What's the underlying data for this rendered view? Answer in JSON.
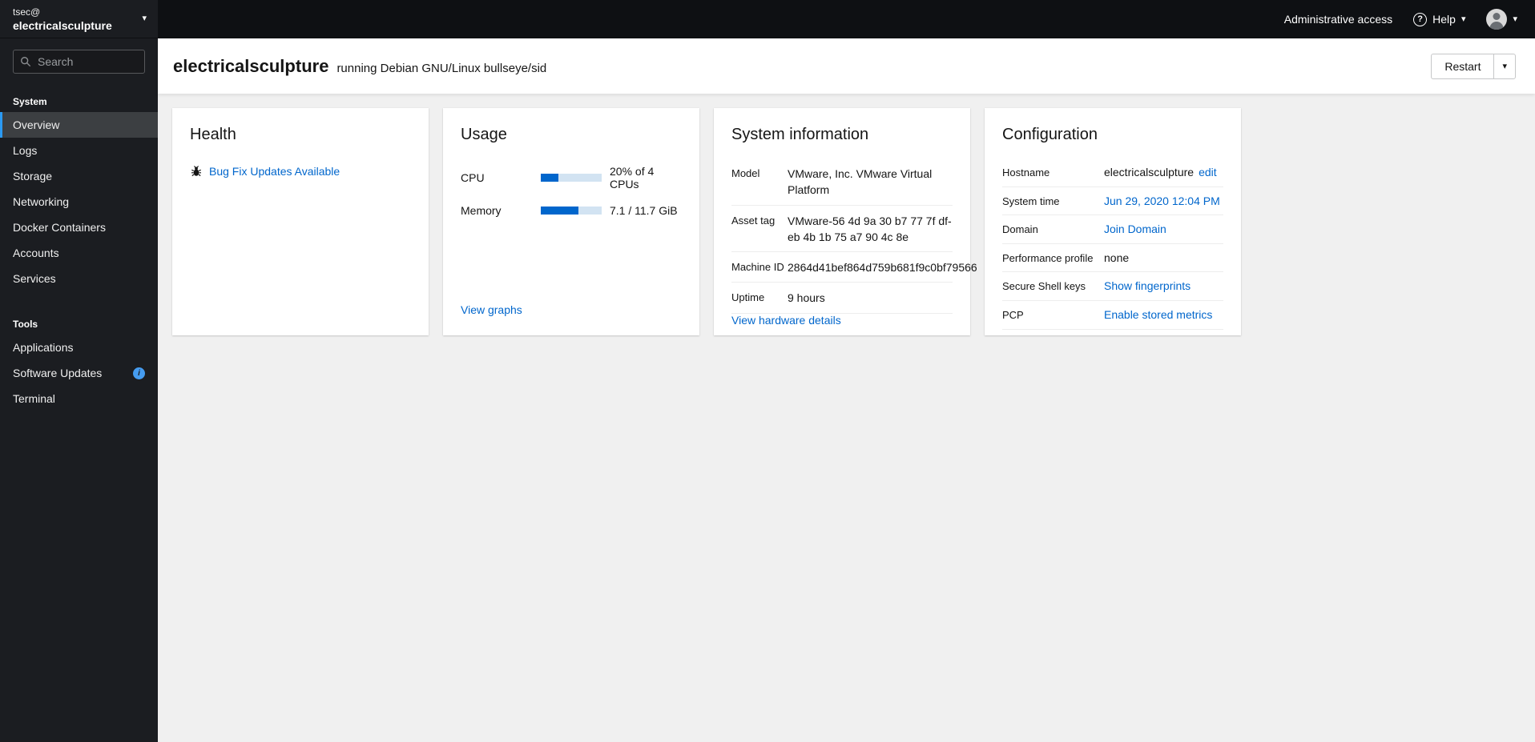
{
  "colors": {
    "accent_blue": "#0066cc",
    "masthead_bg": "#0e1013",
    "sidebar_bg": "#1b1d21",
    "selected_border": "#2b9af3",
    "progress_fill": "#0066cc",
    "progress_track": "#d2e3f2",
    "info_badge": "#459cf0"
  },
  "icons": {
    "caret_down": "▾",
    "question": "?",
    "info": "i"
  },
  "sidebar": {
    "user": "tsec@",
    "host": "electricalsculpture",
    "search_placeholder": "Search",
    "system_section": "System",
    "tools_section": "Tools",
    "system_items": [
      "Overview",
      "Logs",
      "Storage",
      "Networking",
      "Docker Containers",
      "Accounts",
      "Services"
    ],
    "tools_items": [
      "Applications",
      "Software Updates",
      "Terminal"
    ]
  },
  "masthead": {
    "admin_access_label": "Administrative access",
    "help_label": "Help"
  },
  "header": {
    "hostname": "electricalsculpture",
    "subtitle": "running Debian GNU/Linux bullseye/sid",
    "restart_label": "Restart"
  },
  "cards": {
    "health": {
      "title": "Health",
      "update_link": "Bug Fix Updates Available"
    },
    "usage": {
      "title": "Usage",
      "cpu_label": "CPU",
      "cpu_value": "20% of 4 CPUs",
      "cpu_percent": 29,
      "memory_label": "Memory",
      "memory_value": "7.1 / 11.7 GiB",
      "memory_percent": 62,
      "link": "View graphs"
    },
    "system_info": {
      "title": "System information",
      "rows": [
        {
          "term": "Model",
          "value": "VMware, Inc. VMware Virtual Platform"
        },
        {
          "term": "Asset tag",
          "value": "VMware-56 4d 9a 30 b7 77 7f df-eb 4b 1b 75 a7 90 4c 8e"
        },
        {
          "term": "Machine ID",
          "value": "2864d41bef864d759b681f9c0bf79566"
        },
        {
          "term": "Uptime",
          "value": "9 hours"
        }
      ],
      "link": "View hardware details"
    },
    "config": {
      "title": "Configuration",
      "rows": [
        {
          "term": "Hostname",
          "value": "electricalsculpture",
          "action": "edit"
        },
        {
          "term": "System time",
          "value": "Jun 29, 2020 12:04 PM"
        },
        {
          "term": "Domain",
          "value": "Join Domain"
        },
        {
          "term": "Performance profile",
          "value": "none"
        },
        {
          "term": "Secure Shell keys",
          "value": "Show fingerprints"
        },
        {
          "term": "PCP",
          "value": "Enable stored metrics"
        }
      ]
    }
  }
}
